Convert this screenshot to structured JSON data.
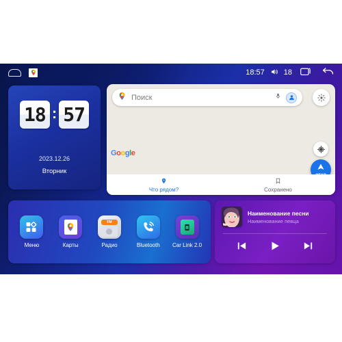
{
  "statusbar": {
    "home_icon": "home-outline-icon",
    "notification_icon": "google-maps-notification-icon",
    "time": "18:57",
    "volume_icon": "volume-icon",
    "volume_level": "18",
    "recents_icon": "recents-square-icon",
    "back_icon": "back-arrow-icon"
  },
  "clock": {
    "hours": "18",
    "separator": ":",
    "minutes": "57",
    "date": "2023.12.26",
    "weekday": "Вторник"
  },
  "maps": {
    "search_placeholder": "Поиск",
    "pin_icon": "map-pin-icon",
    "mic_icon": "microphone-icon",
    "avatar_icon": "account-avatar-icon",
    "layers_icon": "map-layers-icon",
    "locate_icon": "my-location-icon",
    "start_label": "СТАР",
    "start_icon": "navigation-arrow-icon",
    "brand": {
      "g1": "G",
      "o1": "o",
      "o2": "o",
      "g2": "g",
      "l": "l",
      "e": "e"
    },
    "tabs": [
      {
        "label": "Что рядом?",
        "icon": "pin-icon",
        "active": true
      },
      {
        "label": "Сохранено",
        "icon": "bookmark-icon",
        "active": false
      }
    ]
  },
  "apps": [
    {
      "label": "Меню",
      "icon": "apps-grid-icon"
    },
    {
      "label": "Карты",
      "icon": "maps-icon"
    },
    {
      "label": "Радио",
      "icon": "radio-fm-icon",
      "badge": "FM"
    },
    {
      "label": "Bluetooth",
      "icon": "bluetooth-phone-icon"
    },
    {
      "label": "Car Link 2.0",
      "icon": "car-link-icon"
    }
  ],
  "media": {
    "album_art": "portrait-album-art",
    "title": "Наименование песни",
    "artist": "Наименование певца",
    "controls": [
      {
        "name": "previous-button",
        "icon": "skip-previous-icon"
      },
      {
        "name": "play-button",
        "icon": "play-icon"
      },
      {
        "name": "next-button",
        "icon": "skip-next-icon"
      }
    ]
  },
  "colors": {
    "accent_blue": "#1a73e8",
    "panel_purple": "#7a1fc4",
    "panel_blue": "#2048c0",
    "map_bg": "#edeae3"
  }
}
